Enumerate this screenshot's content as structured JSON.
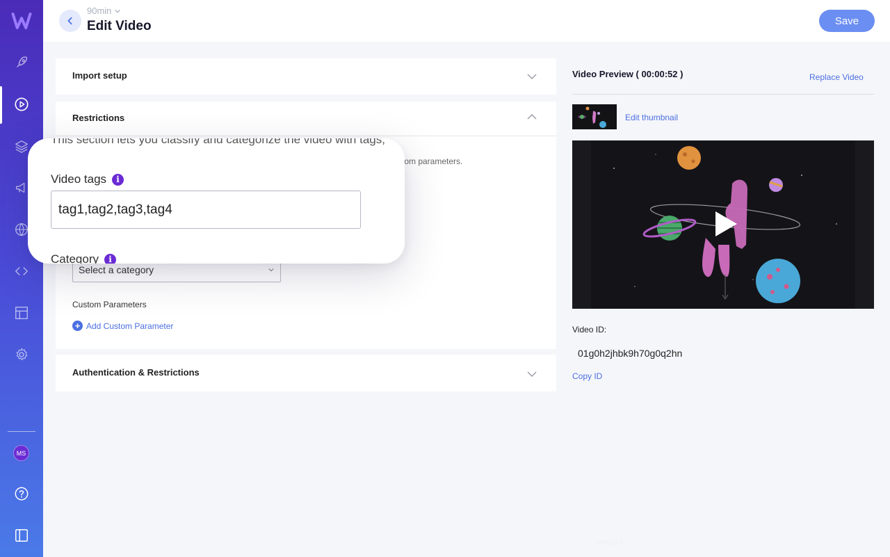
{
  "header": {
    "breadcrumb": "90min",
    "title": "Edit Video",
    "save_label": "Save"
  },
  "sidebar": {
    "items": [
      {
        "icon": "logo-icon"
      },
      {
        "icon": "rocket-icon"
      },
      {
        "icon": "play-icon",
        "active": true
      },
      {
        "icon": "layers-icon"
      },
      {
        "icon": "megaphone-icon"
      },
      {
        "icon": "globe-icon"
      },
      {
        "icon": "code-icon"
      },
      {
        "icon": "layout-icon"
      },
      {
        "icon": "gear-icon"
      },
      {
        "icon": "help-icon"
      },
      {
        "icon": "sidebar-toggle-icon"
      }
    ],
    "avatar_initials": "MS"
  },
  "sections": {
    "import_setup": "Import setup",
    "restrictions": {
      "title": "Restrictions",
      "description_start": "This section lets you classify and categorize the video with tags,",
      "description_end": "tom parameters.",
      "video_tags_label": "Video tags",
      "video_tags_value": "tag1,tag2,tag3,tag4",
      "category_label": "Category",
      "category_placeholder": "Select a category",
      "custom_params_label": "Custom Parameters",
      "add_custom_param": "Add Custom Parameter"
    },
    "auth": "Authentication & Restrictions"
  },
  "preview": {
    "title": "Video Preview ( 00:00:52 )",
    "replace": "Replace Video",
    "edit_thumbnail": "Edit thumbnail",
    "video_id_label": "Video ID:",
    "video_id_value": "01g0h2jhbk9h70g0q2hn",
    "copy_id": "Copy ID"
  },
  "footnote": "0MD1E4",
  "colors": {
    "accent": "#4b6fe0",
    "save_button": "#6b8ef2",
    "info_badge": "#6a2bd4"
  }
}
